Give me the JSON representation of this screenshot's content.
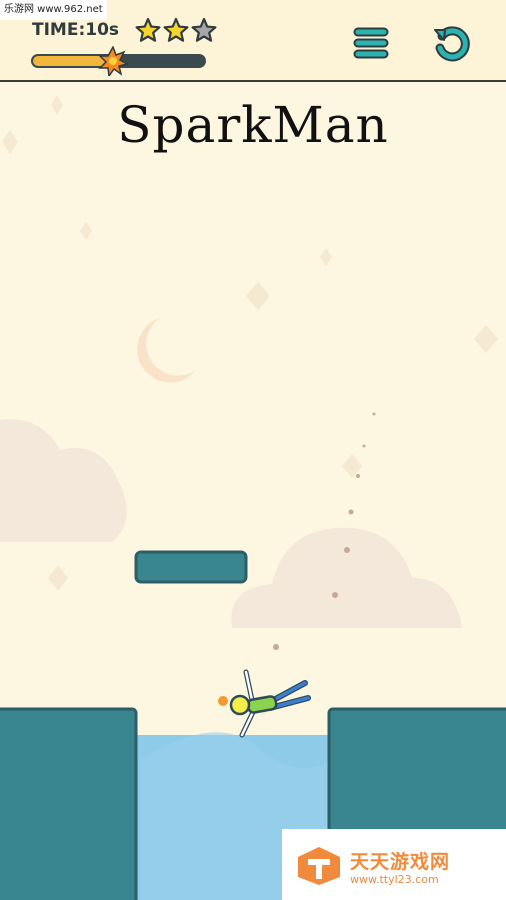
{
  "watermark_top": "乐游网 www.962.net",
  "hud": {
    "timer_label": "TIME:10s",
    "stars": {
      "filled": 2,
      "total": 3
    },
    "progress_fraction": 0.47,
    "menu_icon": "hamburger-menu-icon",
    "restart_icon": "restart-icon"
  },
  "title": "SparkMan",
  "colors": {
    "background": "#fdf6e0",
    "platform": "#3a8690",
    "platform_border": "#2a5f68",
    "water": "#8ecbe9",
    "star_filled": "#f6d42e",
    "star_empty": "#a6a6a6",
    "accent": "#2bb3b0",
    "progress_fill": "#f2b63a"
  },
  "watermark_bottom": {
    "title": "天天游戏网",
    "url": "www.ttyl23.com"
  }
}
